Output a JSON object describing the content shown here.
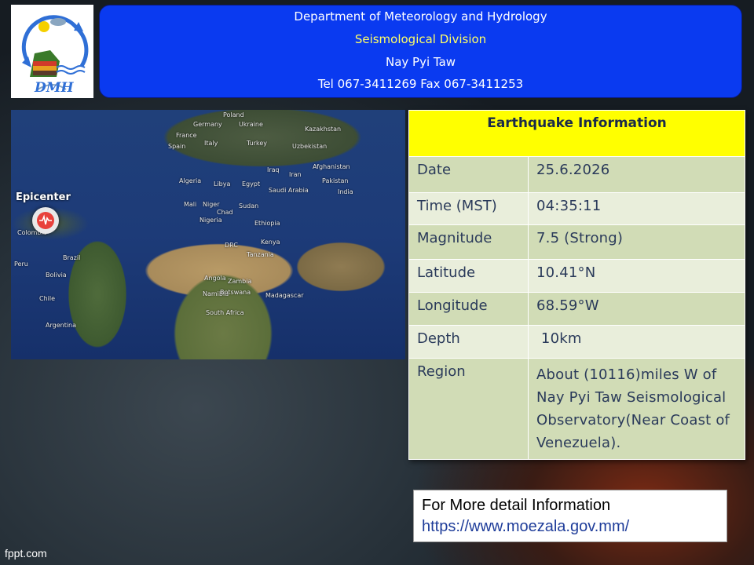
{
  "header": {
    "logo_text": "DMH",
    "line1": "Department of Meteorology and Hydrology",
    "line2": "Seismological  Division",
    "line3": "Nay Pyi Taw",
    "line4": "Tel 067-3411269 Fax 067-3411253"
  },
  "map": {
    "epicenter_label": "Epicenter",
    "countries": [
      "Poland",
      "Germany",
      "Ukraine",
      "Kazakhstan",
      "France",
      "Italy",
      "Turkey",
      "Spain",
      "Uzbekistan",
      "Iraq",
      "Afghanistan",
      "Iran",
      "Algeria",
      "Libya",
      "Egypt",
      "Saudi Arabia",
      "Pakistan",
      "India",
      "Mali",
      "Niger",
      "Chad",
      "Sudan",
      "Nigeria",
      "Ethiopia",
      "Colombia",
      "DRC",
      "Kenya",
      "Brazil",
      "Peru",
      "Tanzania",
      "Bolivia",
      "Angola",
      "Zambia",
      "Namibia",
      "Botswana",
      "Madagascar",
      "Chile",
      "South Africa",
      "Argentina"
    ]
  },
  "info_table": {
    "title": "Earthquake Information",
    "rows": [
      {
        "key": "Date",
        "value": "25.6.2026"
      },
      {
        "key": "Time (MST)",
        "value": "04:35:11"
      },
      {
        "key": "Magnitude",
        "value": "7.5 (Strong)"
      },
      {
        "key": "Latitude",
        "value": "10.41°N"
      },
      {
        "key": "Longitude",
        "value": "68.59°W"
      },
      {
        "key": "Depth",
        "value": " 10km"
      },
      {
        "key": "Region",
        "value": "About (10116)miles W of Nay Pyi Taw Seismological Observatory(Near Coast of Venezuela)."
      }
    ]
  },
  "more_info": {
    "title": "For More detail Information",
    "link": "https://www.moezala.gov.mm/"
  },
  "footer": {
    "watermark": "fppt.com"
  },
  "colors": {
    "header_bg": "#0a3af0",
    "header_highlight": "#ffff66",
    "table_title_bg": "#ffff00",
    "table_row_dark": "#d1dcb6",
    "table_row_light": "#e9eedb",
    "epicenter_marker": "#e8413b"
  }
}
